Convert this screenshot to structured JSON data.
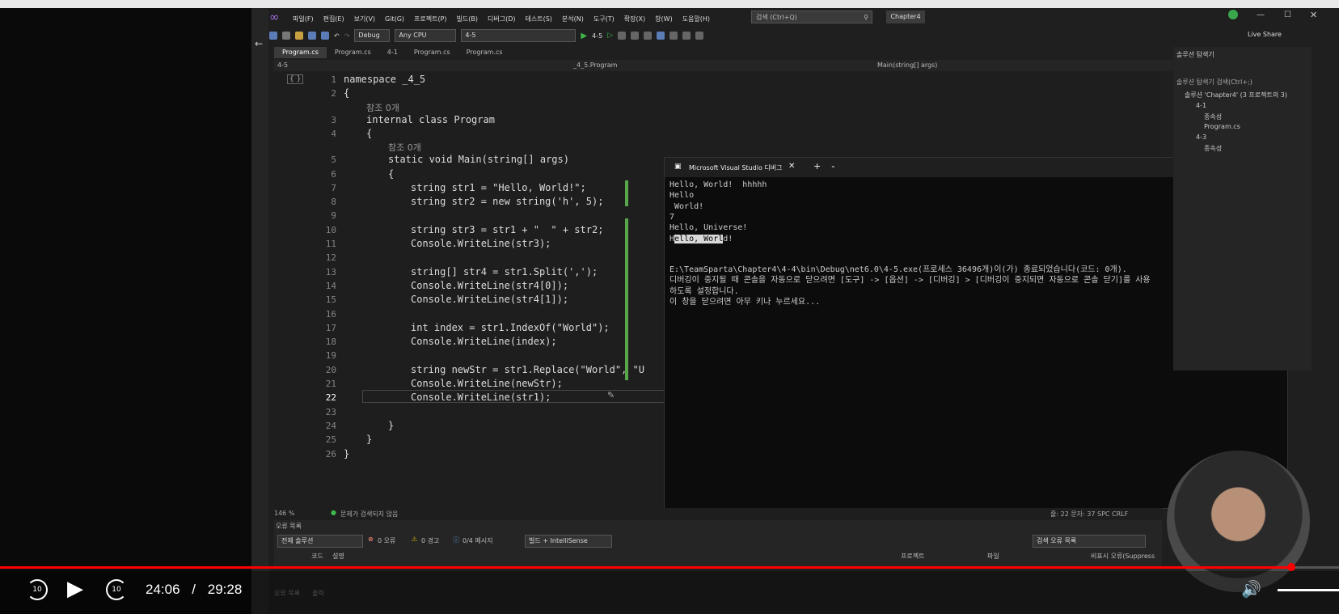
{
  "menu": [
    "파일(F)",
    "편집(E)",
    "보기(V)",
    "Git(G)",
    "프로젝트(P)",
    "빌드(B)",
    "디버그(D)",
    "테스트(S)",
    "분석(N)",
    "도구(T)",
    "확장(X)",
    "창(W)",
    "도움말(H)"
  ],
  "search_placeholder": "검색 (Ctrl+Q)",
  "solution_name": "Chapter4",
  "toolbar": {
    "config": "Debug",
    "platform": "Any CPU",
    "startup": "4-5",
    "run_label": "4-5",
    "live_share": "Live Share"
  },
  "tabs": [
    "Program.cs",
    "Program.cs",
    "4-1",
    "Program.cs",
    "Program.cs"
  ],
  "nav": {
    "project": "4-5",
    "class": "_4_5.Program",
    "member": "Main(string[] args)"
  },
  "editor": {
    "line_numbers": [
      "1",
      "2",
      "3",
      "4",
      "5",
      "6",
      "7",
      "8",
      "9",
      "10",
      "11",
      "12",
      "13",
      "14",
      "15",
      "16",
      "17",
      "18",
      "19",
      "20",
      "21",
      "22",
      "23",
      "24",
      "25",
      "26"
    ],
    "ref0": "참조 0개",
    "ref1": "참조 0개",
    "lines": {
      "l1": "namespace _4_5",
      "l2": "{",
      "l3": "internal class Program",
      "l4": "{",
      "l5": "static void Main(string[] args)",
      "l6": "{",
      "l7": "string str1 = \"Hello, World!\";",
      "l8": "string str2 = new string('h', 5);",
      "l10": "string str3 = str1 + \"  \" + str2;",
      "l11": "Console.WriteLine(str3);",
      "l13": "string[] str4 = str1.Split(',');",
      "l14": "Console.WriteLine(str4[0]);",
      "l15": "Console.WriteLine(str4[1]);",
      "l17": "int index = str1.IndexOf(\"World\");",
      "l18": "Console.WriteLine(index);",
      "l20": "string newStr = str1.Replace(\"World\", \"U",
      "l21": "Console.WriteLine(newStr);",
      "l22": "Console.WriteLine(str1);",
      "l24": "}",
      "l25": "}",
      "l26": "}"
    }
  },
  "console": {
    "title": "Microsoft Visual Studio 디버그",
    "lines": [
      "Hello, World!  hhhhh",
      "Hello",
      " World!",
      "7",
      "Hello, Universe!"
    ],
    "sel_prefix": "H",
    "sel_text": "ello, Worl",
    "sel_suffix": "d!",
    "exit_line": "E:\\TeamSparta\\Chapter4\\4-4\\bin\\Debug\\net6.0\\4-5.exe(프로세스 36496개)이(가) 종료되었습니다(코드: 0개).",
    "info_line1": "디버깅이 중지될 때 콘솔을 자동으로 닫으려면 [도구] -> [옵션] -> [디버깅] > [디버깅이 중지되면 자동으로 콘솔 닫기]를 사용",
    "info_line2": "하도록 설정합니다.",
    "info_line3": "이 창을 닫으려면 아무 키나 누르세요..."
  },
  "status": {
    "zoom": "146 %",
    "issues": "문제가 검색되지 않음",
    "line_col": "줄: 22   문자: 37   SPC   CRLF"
  },
  "errors": {
    "title": "오류 목록",
    "scope": "전체 솔루션",
    "errors": "0 오류",
    "warnings": "0 경고",
    "messages": "0/4 메시지",
    "build": "빌드 + IntelliSense",
    "search": "검색 오류 목록",
    "col_code": "코드",
    "col_desc": "설명",
    "col_project": "프로젝트",
    "col_file": "파일",
    "col_suppress": "비표시 오류(Suppress"
  },
  "bottom_tabs": {
    "errors": "오류 목록",
    "output": "출력"
  },
  "solution_explorer": {
    "title": "솔루션 탐색기",
    "search": "솔루션 탐색기 검색(Ctrl+;)",
    "root": "솔루션 'Chapter4' (3 프로젝트의 3)",
    "items": [
      "4-1",
      "종속성",
      "Program.cs",
      "4-3",
      "종속성"
    ]
  },
  "video": {
    "current": "24:06",
    "separator": "/",
    "total": "29:28",
    "progress": 0.964,
    "skip_back": "10",
    "skip_fwd": "10"
  }
}
